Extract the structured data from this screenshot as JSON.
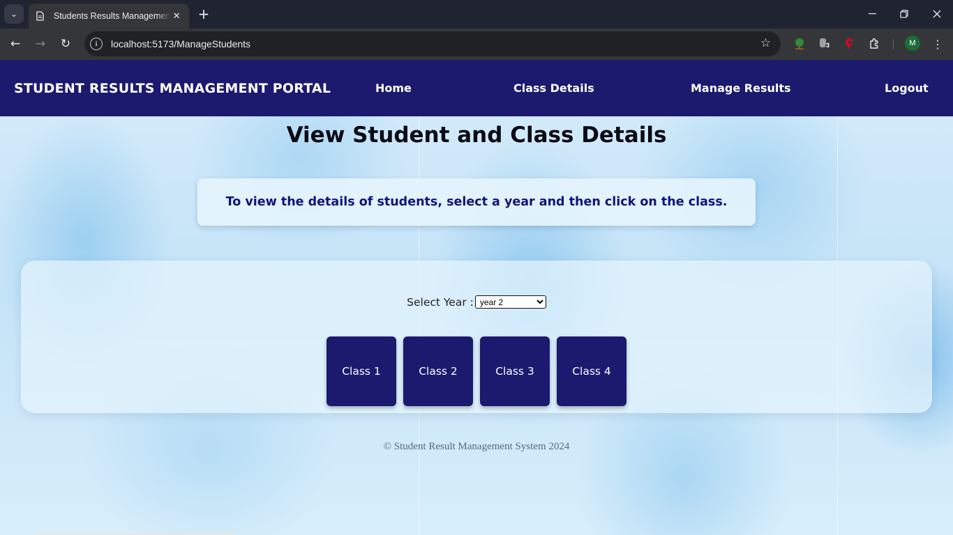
{
  "browser": {
    "tab_title": "Students Results Management Portal",
    "url": "localhost:5173/ManageStudents",
    "extension_badge": "3",
    "profile_initial": "M"
  },
  "app": {
    "brand": "STUDENT RESULTS MANAGEMENT PORTAL",
    "nav": {
      "home": "Home",
      "class_details": "Class Details",
      "manage_results": "Manage Results",
      "logout": "Logout"
    },
    "accent_color": "#1b1a6f"
  },
  "main": {
    "title": "View Student and Class Details",
    "instruction": "To view the details of students, select a year and then click on the class.",
    "year_label": "Select Year :",
    "year_selected": "year 2",
    "classes": [
      "Class 1",
      "Class 2",
      "Class 3",
      "Class 4"
    ]
  },
  "footer": {
    "text": "© Student Result Management System 2024"
  }
}
